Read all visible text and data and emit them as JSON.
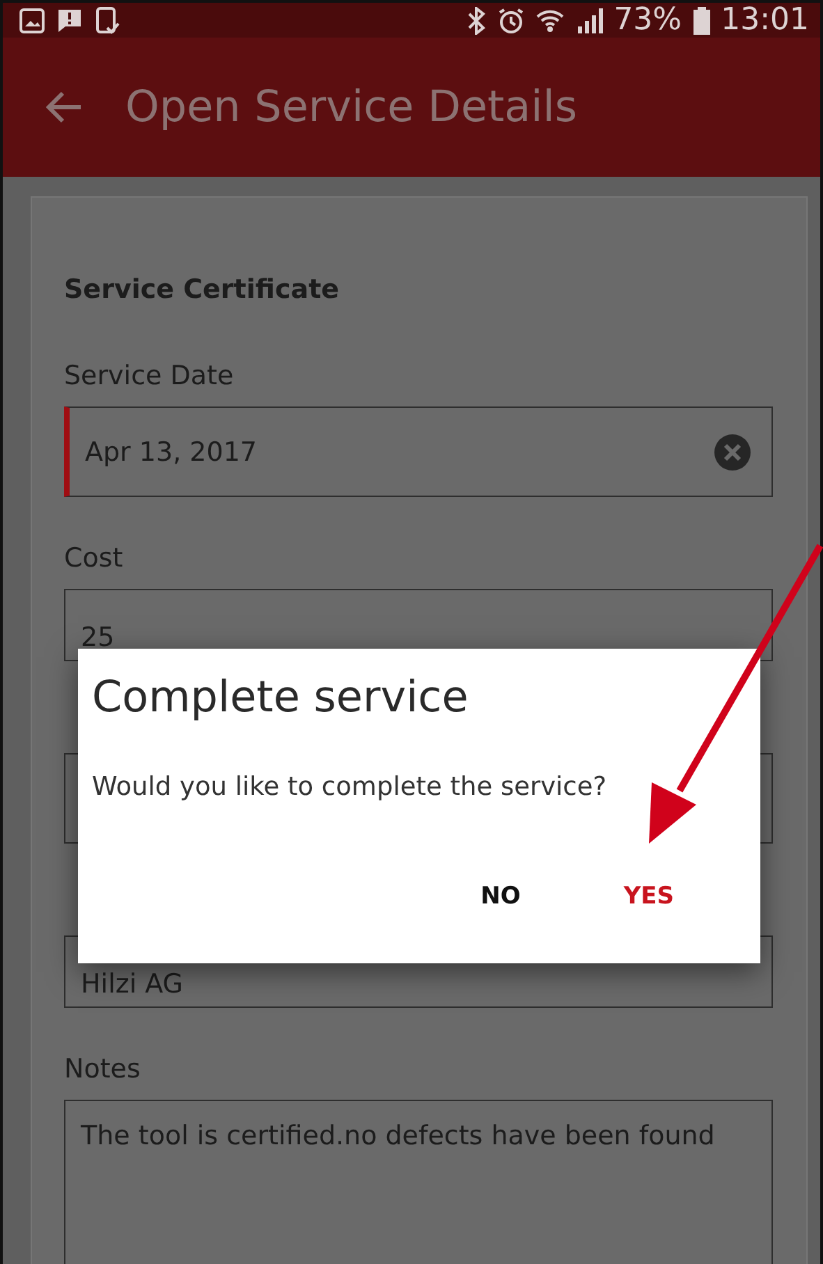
{
  "status_bar": {
    "battery": "73%",
    "time": "13:01"
  },
  "app_bar": {
    "title": "Open Service Details"
  },
  "form": {
    "heading": "Service Certificate",
    "fields": [
      {
        "kind": "date",
        "label": "Service Date",
        "value": "Apr 13, 2017",
        "focused": true,
        "clearable": true
      },
      {
        "kind": "text",
        "label": "Cost",
        "value": "25",
        "focused": false,
        "clearable": false
      },
      {
        "kind": "date",
        "focused": false,
        "clearable": false
      },
      {
        "kind": "text",
        "value": "Hilzi AG",
        "focused": false,
        "clearable": false
      },
      {
        "kind": "textarea",
        "label": "Notes",
        "value": "The tool is certified.no defects have been found",
        "focused": false,
        "clearable": false
      }
    ]
  },
  "dialog": {
    "title": "Complete service",
    "message": "Would you like to complete the service?",
    "buttons": [
      {
        "kind": "neutral",
        "label": "NO"
      },
      {
        "kind": "primary",
        "label": "YES"
      }
    ]
  }
}
